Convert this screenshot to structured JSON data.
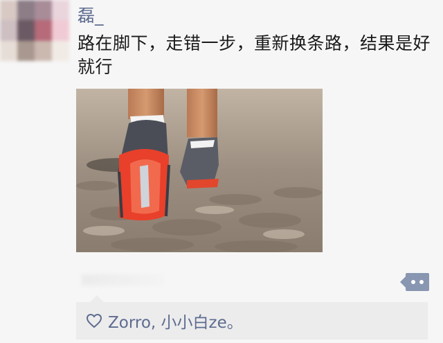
{
  "post": {
    "author": "磊_",
    "text": "路在脚下，走错一步，重新换条路，结果是好就行"
  },
  "likes": {
    "names": "Zorro, 小小白ze。"
  },
  "icons": {
    "heart": "heart-icon",
    "action": "more-dots-icon"
  },
  "colors": {
    "name_link": "#5d6b8f",
    "action_button": "#8896b1",
    "likes_background": "#ececec"
  }
}
